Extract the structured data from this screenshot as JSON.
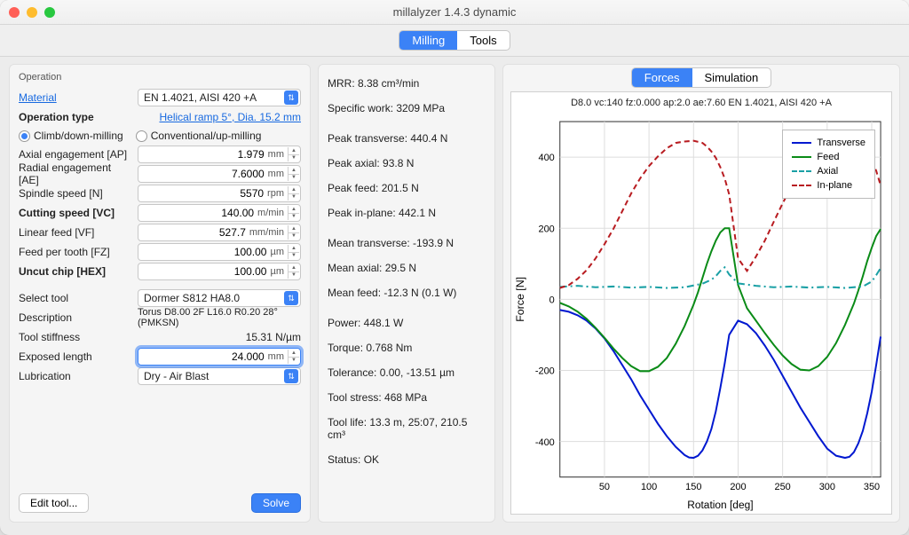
{
  "window": {
    "title": "millalyzer 1.4.3 dynamic"
  },
  "toolbar": {
    "tabs": [
      "Milling",
      "Tools"
    ],
    "active": 0
  },
  "operation": {
    "section": "Operation",
    "material_label": "Material",
    "material_value": "EN 1.4021, AISI 420 +A",
    "operation_type_label": "Operation type",
    "helical_link": "Helical ramp 5°, Dia. 15.2 mm",
    "radios": {
      "climb": "Climb/down-milling",
      "conventional": "Conventional/up-milling",
      "selected": "climb"
    },
    "params": [
      {
        "label": "Axial engagement [AP]",
        "value": "1.979",
        "unit": "mm",
        "bold": false
      },
      {
        "label": "Radial engagement [AE]",
        "value": "7.6000",
        "unit": "mm",
        "bold": false
      },
      {
        "label": "Spindle speed [N]",
        "value": "5570",
        "unit": "rpm",
        "bold": false
      },
      {
        "label": "Cutting speed [VC]",
        "value": "140.00",
        "unit": "m/min",
        "bold": true
      },
      {
        "label": "Linear feed [VF]",
        "value": "527.7",
        "unit": "mm/min",
        "bold": false
      },
      {
        "label": "Feed per tooth [FZ]",
        "value": "100.00",
        "unit": "µm",
        "bold": false
      },
      {
        "label": "Uncut chip [HEX]",
        "value": "100.00",
        "unit": "µm",
        "bold": true
      }
    ],
    "tool": {
      "select_label": "Select tool",
      "select_value": "Dormer S812 HA8.0",
      "description_label": "Description",
      "description_value": "Torus D8.00 2F L16.0 R0.20 28° (PMKSN)",
      "stiffness_label": "Tool stiffness",
      "stiffness_value": "15.31 N/µm",
      "exposed_label": "Exposed length",
      "exposed_value": "24.000",
      "exposed_unit": "mm",
      "lubrication_label": "Lubrication",
      "lubrication_value": "Dry - Air Blast"
    },
    "edit_tool_btn": "Edit tool...",
    "solve_btn": "Solve"
  },
  "results": {
    "lines": [
      "MRR: 8.38 cm³/min",
      "Specific work: 3209 MPa",
      "",
      "Peak transverse: 440.4 N",
      "Peak axial: 93.8 N",
      "Peak feed: 201.5 N",
      "Peak in-plane: 442.1 N",
      "",
      "Mean transverse: -193.9 N",
      "Mean axial: 29.5 N",
      "Mean feed: -12.3 N (0.1 W)",
      "",
      "Power: 448.1 W",
      "Torque: 0.768 Nm",
      "Tolerance: 0.00, -13.51 µm",
      "Tool stress: 468 MPa",
      "Tool life: 13.3 m, 25:07, 210.5 cm³",
      "Status: OK"
    ]
  },
  "chart_tabs": {
    "tabs": [
      "Forces",
      "Simulation"
    ],
    "active": 0
  },
  "chart_data": {
    "type": "line",
    "title": "D8.0 vc:140 fz:0.000 ap:2.0 ae:7.60 EN 1.4021, AISI 420 +A",
    "xlabel": "Rotation [deg]",
    "ylabel": "Force [N]",
    "xlim": [
      0,
      360
    ],
    "ylim": [
      -500,
      500
    ],
    "xticks": [
      50,
      100,
      150,
      200,
      250,
      300,
      350
    ],
    "yticks": [
      -400,
      -200,
      0,
      200,
      400
    ],
    "legend_position": "upper right",
    "series": [
      {
        "name": "Transverse",
        "color": "#0018d0",
        "dash": "solid",
        "x": [
          0,
          10,
          20,
          30,
          40,
          50,
          60,
          70,
          80,
          90,
          100,
          110,
          120,
          130,
          140,
          145,
          150,
          155,
          160,
          165,
          170,
          175,
          180,
          185,
          190,
          200,
          210,
          220,
          230,
          240,
          250,
          260,
          270,
          280,
          290,
          300,
          310,
          320,
          325,
          330,
          335,
          340,
          345,
          350,
          355,
          360
        ],
        "y": [
          -30,
          -35,
          -45,
          -60,
          -82,
          -110,
          -145,
          -185,
          -225,
          -270,
          -310,
          -350,
          -385,
          -415,
          -438,
          -445,
          -446,
          -440,
          -425,
          -400,
          -365,
          -315,
          -250,
          -180,
          -100,
          -60,
          -70,
          -95,
          -130,
          -170,
          -215,
          -260,
          -305,
          -345,
          -385,
          -420,
          -440,
          -446,
          -443,
          -430,
          -405,
          -370,
          -320,
          -260,
          -185,
          -105
        ]
      },
      {
        "name": "Feed",
        "color": "#0a8b17",
        "dash": "solid",
        "x": [
          0,
          10,
          20,
          30,
          40,
          50,
          60,
          70,
          80,
          90,
          100,
          110,
          120,
          130,
          140,
          150,
          155,
          160,
          165,
          170,
          175,
          180,
          185,
          190,
          200,
          210,
          220,
          230,
          240,
          250,
          260,
          270,
          280,
          290,
          300,
          310,
          320,
          330,
          335,
          340,
          345,
          350,
          355,
          360
        ],
        "y": [
          -10,
          -20,
          -35,
          -55,
          -80,
          -108,
          -138,
          -165,
          -188,
          -202,
          -202,
          -190,
          -165,
          -125,
          -75,
          -15,
          20,
          60,
          100,
          135,
          165,
          188,
          200,
          200,
          40,
          -25,
          -60,
          -95,
          -128,
          -158,
          -182,
          -198,
          -200,
          -188,
          -162,
          -123,
          -72,
          -12,
          25,
          65,
          108,
          145,
          178,
          198
        ]
      },
      {
        "name": "Axial",
        "color": "#1aa0a5",
        "dash": "dashdot",
        "x": [
          0,
          20,
          40,
          60,
          80,
          100,
          120,
          140,
          160,
          170,
          175,
          180,
          185,
          190,
          200,
          220,
          240,
          260,
          280,
          300,
          320,
          340,
          350,
          355,
          360
        ],
        "y": [
          35,
          38,
          34,
          36,
          33,
          35,
          32,
          34,
          44,
          55,
          65,
          80,
          90,
          70,
          45,
          38,
          34,
          36,
          33,
          35,
          32,
          36,
          50,
          68,
          88
        ]
      },
      {
        "name": "In-plane",
        "color": "#b81c21",
        "dash": "dashed",
        "x": [
          0,
          10,
          20,
          30,
          40,
          50,
          60,
          70,
          80,
          90,
          100,
          110,
          120,
          130,
          140,
          150,
          160,
          165,
          170,
          175,
          180,
          185,
          190,
          200,
          210,
          220,
          230,
          240,
          250,
          260,
          270,
          280,
          290,
          300,
          310,
          320,
          330,
          340,
          345,
          350,
          355,
          360
        ],
        "y": [
          32,
          40,
          58,
          82,
          115,
          155,
          198,
          248,
          298,
          340,
          375,
          402,
          425,
          440,
          444,
          446,
          440,
          430,
          416,
          398,
          372,
          340,
          295,
          115,
          80,
          120,
          165,
          218,
          270,
          318,
          360,
          395,
          422,
          440,
          446,
          444,
          435,
          418,
          405,
          388,
          362,
          320
        ]
      }
    ]
  }
}
